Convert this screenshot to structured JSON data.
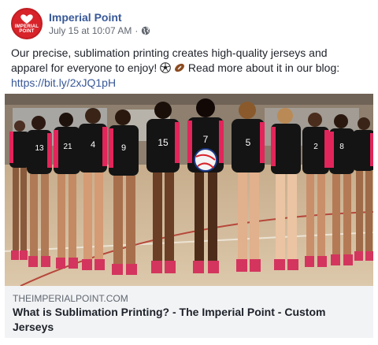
{
  "post": {
    "page_name": "Imperial Point",
    "timestamp": "July 15 at 10:07 AM",
    "separator": "·",
    "avatar_text": "IMPERIAL POINT",
    "text_before_emoji": "Our precise, sublimation printing creates high-quality jerseys and apparel for everyone to enjoy!",
    "text_after_emoji": "Read more about it in our blog:",
    "link": "https://bit.ly/2xJQ1pH",
    "emoji_icons": [
      "soccer-ball-icon",
      "football-icon"
    ]
  },
  "link_preview": {
    "domain": "THEIMPERIALPOINT.COM",
    "title": "What is Sublimation Printing? - The Imperial Point - Custom Jerseys",
    "jersey_numbers": [
      "13",
      "21",
      "4",
      "9",
      "15",
      "7",
      "5",
      "2",
      "8"
    ]
  },
  "colors": {
    "accent_link": "#385898",
    "brand_red": "#d8232a",
    "jersey_black": "#141414",
    "jersey_pink": "#e2255a"
  }
}
